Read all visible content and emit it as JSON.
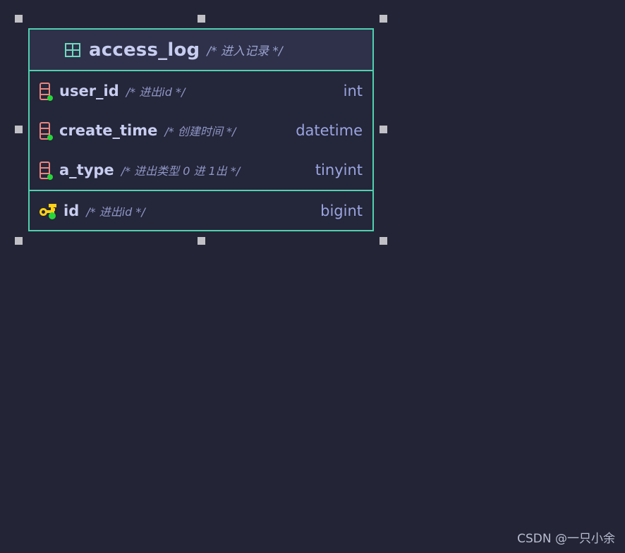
{
  "canvas": {
    "background_color": "#232536"
  },
  "entity": {
    "selected": true,
    "border_color": "#4fd1b0",
    "header": {
      "icon": "table-grid-icon",
      "name": "access_log",
      "comment": "/* 进入记录 */",
      "background_color": "#2e3149",
      "text_color": "#c8cdf0"
    },
    "fields": [
      {
        "icon": "column-icon",
        "name": "user_id",
        "comment": "/* 进出id */",
        "type": "int",
        "primary_key": false
      },
      {
        "icon": "column-icon",
        "name": "create_time",
        "comment": "/* 创建时间 */",
        "type": "datetime",
        "primary_key": false
      },
      {
        "icon": "column-icon",
        "name": "a_type",
        "comment": "/* 进出类型 0 进 1出 */",
        "type": "tinyint",
        "primary_key": false
      },
      {
        "icon": "primary-key-icon",
        "name": "id",
        "comment": "/* 进出id */",
        "type": "bigint",
        "primary_key": true
      }
    ]
  },
  "watermark": {
    "text": "CSDN @一只小余"
  }
}
